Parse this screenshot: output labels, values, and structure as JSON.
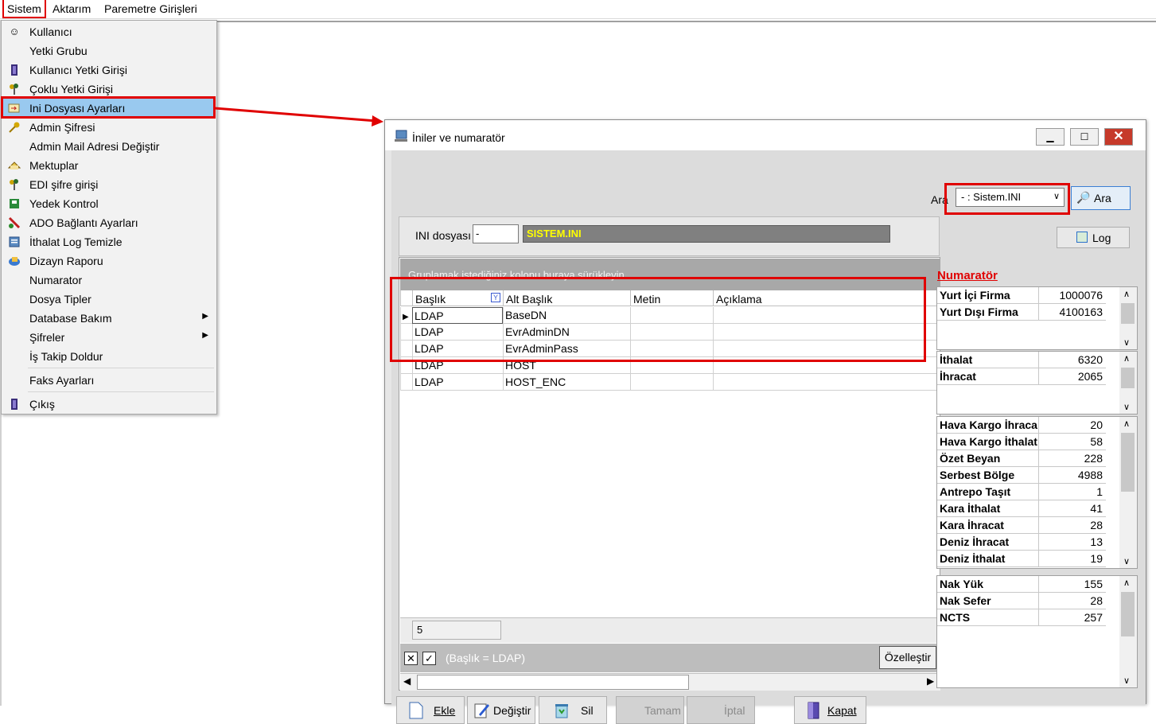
{
  "menubar": {
    "items": [
      "Sistem",
      "Aktarım",
      "Paremetre Girişleri"
    ]
  },
  "dropdown": {
    "items": [
      {
        "label": "Kullanıcı",
        "icon": "user-icon"
      },
      {
        "label": "Yetki Grubu",
        "icon": ""
      },
      {
        "label": "Kullanıcı Yetki Girişi",
        "icon": "door-icon"
      },
      {
        "label": "Çoklu Yetki Girişi",
        "icon": "key-group-icon"
      },
      {
        "label": "Ini Dosyası  Ayarları",
        "icon": "settings-file-icon"
      },
      {
        "label": "Admin Şifresi",
        "icon": "key-icon"
      },
      {
        "label": "Admin Mail Adresi Değiştir",
        "icon": ""
      },
      {
        "label": "Mektuplar",
        "icon": "letter-icon"
      },
      {
        "label": "EDI şifre girişi",
        "icon": "key-group-icon"
      },
      {
        "label": "Yedek Kontrol",
        "icon": "backup-icon"
      },
      {
        "label": "ADO Bağlantı Ayarları",
        "icon": "connection-icon"
      },
      {
        "label": "İthalat Log Temizle",
        "icon": "log-icon"
      },
      {
        "label": "Dizayn Raporu",
        "icon": "report-icon"
      },
      {
        "label": "Numarator",
        "icon": ""
      },
      {
        "label": "Dosya Tipler",
        "icon": ""
      },
      {
        "label": "Database Bakım",
        "icon": ""
      },
      {
        "label": "Şifreler",
        "icon": ""
      },
      {
        "label": "İş Takip Doldur",
        "icon": ""
      },
      {
        "label": "Faks Ayarları",
        "icon": ""
      },
      {
        "label": "Çıkış",
        "icon": "exit-door-icon"
      }
    ]
  },
  "dialog": {
    "title": "İniler ve numaratör",
    "search": {
      "label": "Ara",
      "selected": "- : Sistem.INI",
      "button": "Ara"
    },
    "ini": {
      "label": "INI dosyası",
      "input": "-",
      "file": "SISTEM.INI"
    },
    "log_button": "Log",
    "grid": {
      "group_hint": "Gruplamak istediğiniz kolonu buraya sürükleyin",
      "columns": [
        "Başlık",
        "Alt Başlık",
        "Metin",
        "Açıklama"
      ],
      "rows": [
        [
          "LDAP",
          "BaseDN",
          "",
          ""
        ],
        [
          "LDAP",
          "EvrAdminDN",
          "",
          ""
        ],
        [
          "LDAP",
          "EvrAdminPass",
          "",
          ""
        ],
        [
          "LDAP",
          "HOST",
          "",
          ""
        ],
        [
          "LDAP",
          "HOST_ENC",
          "",
          ""
        ]
      ],
      "count": "5",
      "filter": "(Başlık = LDAP)",
      "customize": "Özelleştir"
    },
    "numarator": {
      "title": "Numaratör",
      "panel1": [
        [
          "Yurt İçi Firma",
          "1000076"
        ],
        [
          "Yurt Dışı Firma",
          "4100163"
        ]
      ],
      "panel2": [
        [
          "İthalat",
          "6320"
        ],
        [
          "İhracat",
          "2065"
        ]
      ],
      "panel3": [
        [
          "Hava Kargo İhracat",
          "20"
        ],
        [
          "Hava Kargo İthalat",
          "58"
        ],
        [
          "Özet Beyan",
          "228"
        ],
        [
          "Serbest Bölge",
          "4988"
        ],
        [
          "Antrepo Taşıt",
          "1"
        ],
        [
          "Kara İthalat",
          "41"
        ],
        [
          "Kara İhracat",
          "28"
        ],
        [
          "Deniz İhracat",
          "13"
        ],
        [
          "Deniz İthalat",
          "19"
        ]
      ],
      "panel4": [
        [
          "Nak Yük",
          "155"
        ],
        [
          "Nak Sefer",
          "28"
        ],
        [
          "NCTS",
          "257"
        ]
      ]
    },
    "buttons": {
      "ekle": "Ekle",
      "degistir": "Değiştir",
      "sil": "Sil",
      "tamam": "Tamam",
      "iptal": "İptal",
      "kapat": "Kapat"
    }
  },
  "colors": {
    "highlight": "#e00000",
    "selected_item": "#99c9ef"
  }
}
